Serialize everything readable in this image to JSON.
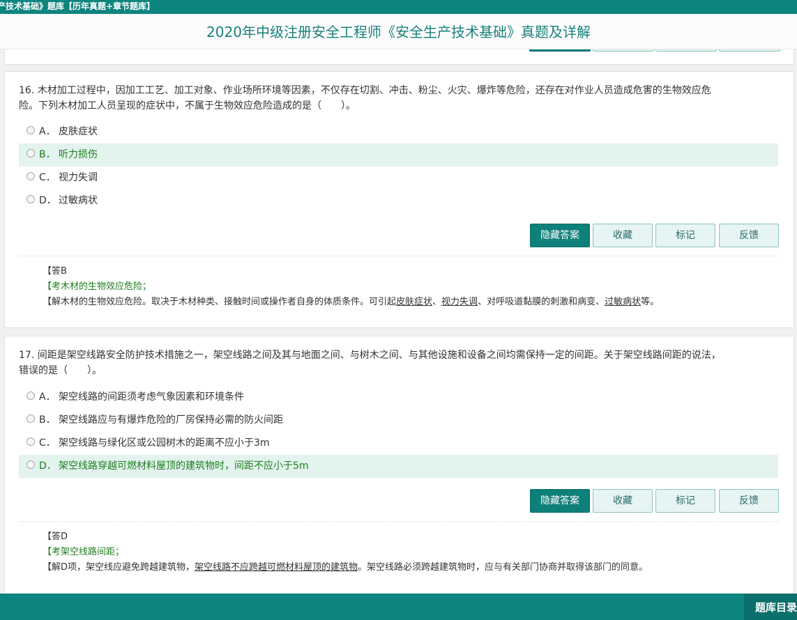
{
  "topbar": {
    "text": "产技术基础》题库【历年真题+章节题库】"
  },
  "page_title": "2020年中级注册安全工程师《安全生产技术基础》真题及详解",
  "buttons": {
    "hide_answer": "隐藏答案",
    "favorite": "收藏",
    "mark": "标记",
    "feedback": "反馈"
  },
  "questions": [
    {
      "stem_line1": "16. 木材加工过程中，因加工工艺、加工对象、作业场所环境等因素，不仅存在切割、冲击、粉尘、火灾、爆炸等危险，还存在对作业人员造成危害的生物效应危",
      "stem_line2": "险。下列木材加工人员呈现的症状中，不属于生物效应危险造成的是（　　）。",
      "options": [
        {
          "key": "A．",
          "text": "皮肤症状"
        },
        {
          "key": "B．",
          "text": "听力损伤"
        },
        {
          "key": "C．",
          "text": "视力失调"
        },
        {
          "key": "D．",
          "text": "过敏病状"
        }
      ],
      "answer": "【答B",
      "knowledge": "【考木材的生物效应危险；",
      "explain": {
        "p1": "【解木材的生物效应危险。取决于木材种类、接触时间或操作者自身的体质条件。可引起",
        "u1": "皮肤症状",
        "p2": "、",
        "u2": "视力失调",
        "p3": "、对呼吸道黏膜的刺激和病变、",
        "u3": "过敏病状",
        "p4": "等。"
      }
    },
    {
      "stem_line1": "17. 间距是架空线路安全防护技术措施之一，架空线路之间及其与地面之间、与树木之间、与其他设施和设备之间均需保持一定的间距。关于架空线路间距的说法，",
      "stem_line2": "错误的是（　　）。",
      "options": [
        {
          "key": "A．",
          "text": "架空线路的间距须考虑气象因素和环境条件"
        },
        {
          "key": "B．",
          "text": "架空线路应与有爆炸危险的厂房保持必需的防火间距"
        },
        {
          "key": "C．",
          "text": "架空线路与绿化区或公园树木的距离不应小于3m"
        },
        {
          "key": "D．",
          "text": "架空线路穿越可燃材料屋顶的建筑物时，间距不应小于5m"
        }
      ],
      "answer": "【答D",
      "knowledge": "【考架空线路间距；",
      "explain": {
        "p1": "【解D项，架空线应避免跨越建筑物，",
        "u1": "架空线路不应跨越可燃材料屋顶的建筑物",
        "p2": "。架空线路必须跨越建筑物时，应与有关部门协商并取得该部门的同意。"
      }
    }
  ],
  "bottom": {
    "tab_label": "题库目录"
  },
  "colors": {
    "brand": "#0e847f",
    "correct_bg": "#e3f3ee",
    "correct_text": "#1d7d1d"
  }
}
